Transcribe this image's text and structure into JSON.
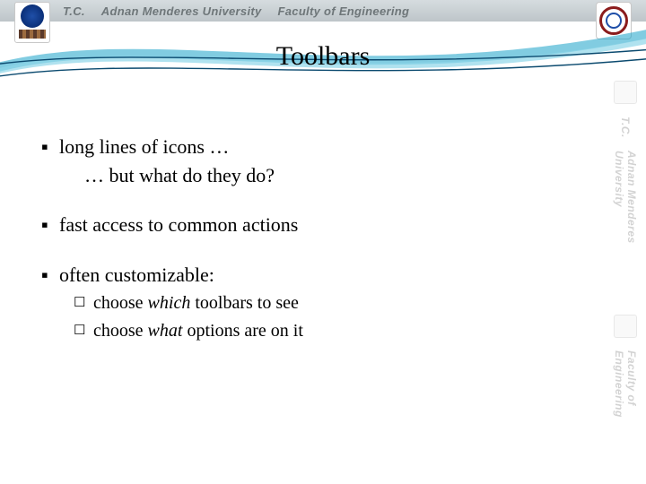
{
  "header": {
    "tc": "T.C.",
    "university": "Adnan Menderes University",
    "faculty": "Faculty of Engineering"
  },
  "title": "Toolbars",
  "bullets": {
    "b1_line1": "long lines of icons …",
    "b1_line2": "… but what do they do?",
    "b2": "fast access to common actions",
    "b3": "often customizable:",
    "b3_sub1_pre": "choose ",
    "b3_sub1_em": "which",
    "b3_sub1_post": " toolbars to see",
    "b3_sub2_pre": "choose ",
    "b3_sub2_em": "what",
    "b3_sub2_post": " options are on it"
  },
  "watermark": {
    "tc": "T.C.",
    "university": "Adnan Menderes University",
    "faculty": "Faculty of Engineering"
  },
  "marks": {
    "square": "▪",
    "box": "☐"
  }
}
